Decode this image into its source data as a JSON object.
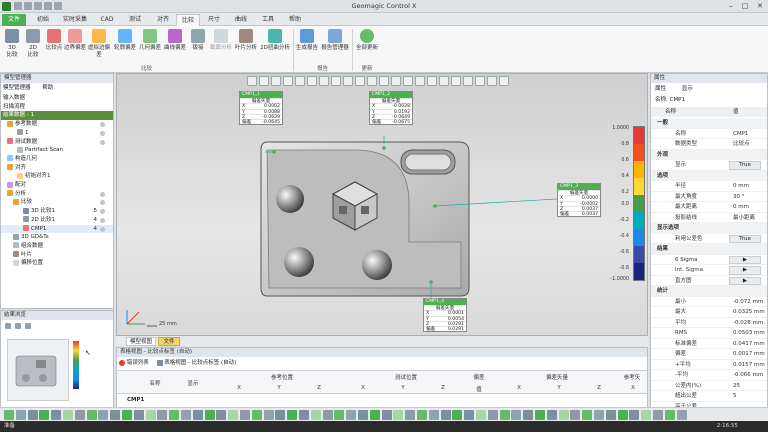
{
  "app": {
    "title": "Geomagic Control X"
  },
  "tabs": {
    "file": "文件",
    "t1": "初始",
    "t2": "实时采集",
    "t3": "CAD",
    "t4": "测试",
    "t5": "对齐",
    "t6": "比较",
    "t7": "尺寸",
    "t8": "曲线",
    "t9": "工具",
    "t10": "帮助"
  },
  "ribbon": {
    "b1": "3D\n比较",
    "b2": "2D\n比较",
    "b3": "比较点",
    "b4": "边界偏差",
    "b5": "虚拟边偏差",
    "b6": "轮廓偏差",
    "b7": "几何偏差",
    "b8": "曲线偏差",
    "b9": "钣接",
    "b10": "截面分析",
    "b11": "叶片分析",
    "b12": "2D扭曲分析",
    "b13": "生成报告",
    "b14": "报告管理器",
    "b15": "全部更新",
    "g1": "比较",
    "g2": "报告",
    "g3": "更新"
  },
  "left": {
    "title": "模型管理器",
    "tab1": "模型管理器",
    "tab2": "帮助",
    "r1": "输入数据",
    "r2": "扫描流程",
    "r3": "结果数据 - 1",
    "r4": "参考数据",
    "r5": "1",
    "r6": "测试数据",
    "r7": "Partifact Scan",
    "r8": "构造几何",
    "r9": "对齐",
    "r10": "初始对齐1",
    "r11": "配对",
    "r12": "分析",
    "r13": "比较",
    "r14": "3D 比较1",
    "r14n": "5",
    "r15": "2D 比较1",
    "r15n": "4",
    "r16": "CMP1",
    "r16n": "4",
    "r17": "3D GD&Ts",
    "r18": "组合数据",
    "r19": "叶片",
    "r20": "偏移位置",
    "view_title": "结果浏览",
    "zoom": "自动"
  },
  "viewport": {
    "scale": "25 mm",
    "tabs": {
      "t1": "模型视图",
      "t2": "文件"
    },
    "callouts": {
      "c1": {
        "name": "CMP1_1",
        "head": "偏差矢量",
        "x": "0.0002",
        "y": "0.0088",
        "z": "-0.0639",
        "d": "-0.0645"
      },
      "c2": {
        "name": "CMP1_2",
        "head": "偏差矢量",
        "x": "-0.0028",
        "y": "0.0192",
        "z": "-0.0649",
        "d": "-0.0675"
      },
      "c3": {
        "name": "CMP1_3",
        "head": "偏差矢量",
        "x": "0.0000",
        "y": "-0.0002",
        "z": "0.0037",
        "d": "0.0037"
      },
      "c4": {
        "name": "CMP1_4",
        "head": "偏差矢量",
        "x": "0.0001",
        "y": "0.0054",
        "z": "0.0291",
        "d": "0.0291"
      }
    },
    "labels": {
      "x": "X",
      "y": "Y",
      "z": "Z",
      "d": "偏差"
    },
    "colorbar": {
      "max": "1.0000",
      "p8": "0.8",
      "p6": "0.6",
      "p4": "0.4",
      "p2": "0.2",
      "zero": "0.0",
      "n2": "-0.2",
      "n4": "-0.4",
      "n6": "-0.6",
      "n8": "-0.8",
      "min": "-1.0000"
    },
    "colors": {
      "c1": "#e53935",
      "c2": "#f4511e",
      "c3": "#ffb300",
      "c4": "#fdd835",
      "c5": "#43a047",
      "c6": "#00acc1",
      "c7": "#1e88e5",
      "c8": "#3949ab",
      "c9": "#1a237e"
    }
  },
  "props": {
    "title": "属性",
    "tab1": "属性",
    "tab2": "显示",
    "name_label": "名称: CMP1",
    "col1": "名称",
    "col2": "值",
    "c_general": "一般",
    "name_k": "名称",
    "name_v": "CMP1",
    "type_k": "数据类型",
    "type_v": "比较点",
    "c_ext": "外观",
    "show_k": "显示",
    "show_v": "True",
    "c_opt": "选项",
    "r_k": "半径",
    "r_v": "0 mm",
    "maxang_k": "最大角度",
    "maxang_v": "30 °",
    "maxdist_k": "最大距离",
    "maxdist_v": "0 mm",
    "proj_k": "投影结线",
    "proj_v": "最小距离",
    "c_disp": "显示选项",
    "usecolor_k": "利用公差色",
    "usecolor_v": "True",
    "c_res": "结果",
    "sig_k": "6 Sigma",
    "int_k": "Int. Sigma",
    "hist_k": "直方图",
    "c_stat": "统计",
    "min_k": "最小",
    "min_v": "-0.072 mm",
    "max_k": "最大",
    "max_v": "0.0325 mm",
    "avg_k": "平均",
    "avg_v": "-0.028 mm",
    "rms_k": "RMS",
    "rms_v": "0.0503 mm",
    "std_k": "标准偏差",
    "std_v": "0.0417 mm",
    "var_k": "偏差",
    "var_v": "0.0017 mm",
    "pavg_k": "+平均",
    "pavg_v": "0.0157 mm",
    "navg_k": "-平均",
    "navg_v": "-0.066 mm",
    "tol_k": "公差内(%)",
    "tol_v": "25",
    "out_k": "超出公差",
    "out_v": "5",
    "outp_k": "高于公差"
  },
  "bottom": {
    "title": "表格视图 - 比较点标签 (自动)",
    "tab1": "错误列表",
    "tab2": "表格视图 - 比较点标签 (自动)",
    "h_name": "名称",
    "h_show": "显示",
    "h_ref": "参考位置",
    "h_meas": "测试位置",
    "h_dev": "偏差",
    "h_vec": "偏差矢量",
    "h_vec2": "参考矢",
    "x": "X",
    "y": "Y",
    "z": "Z",
    "val": "值",
    "row1": "CMP1"
  },
  "status": {
    "left": "准备",
    "clock": "2:16:55"
  }
}
